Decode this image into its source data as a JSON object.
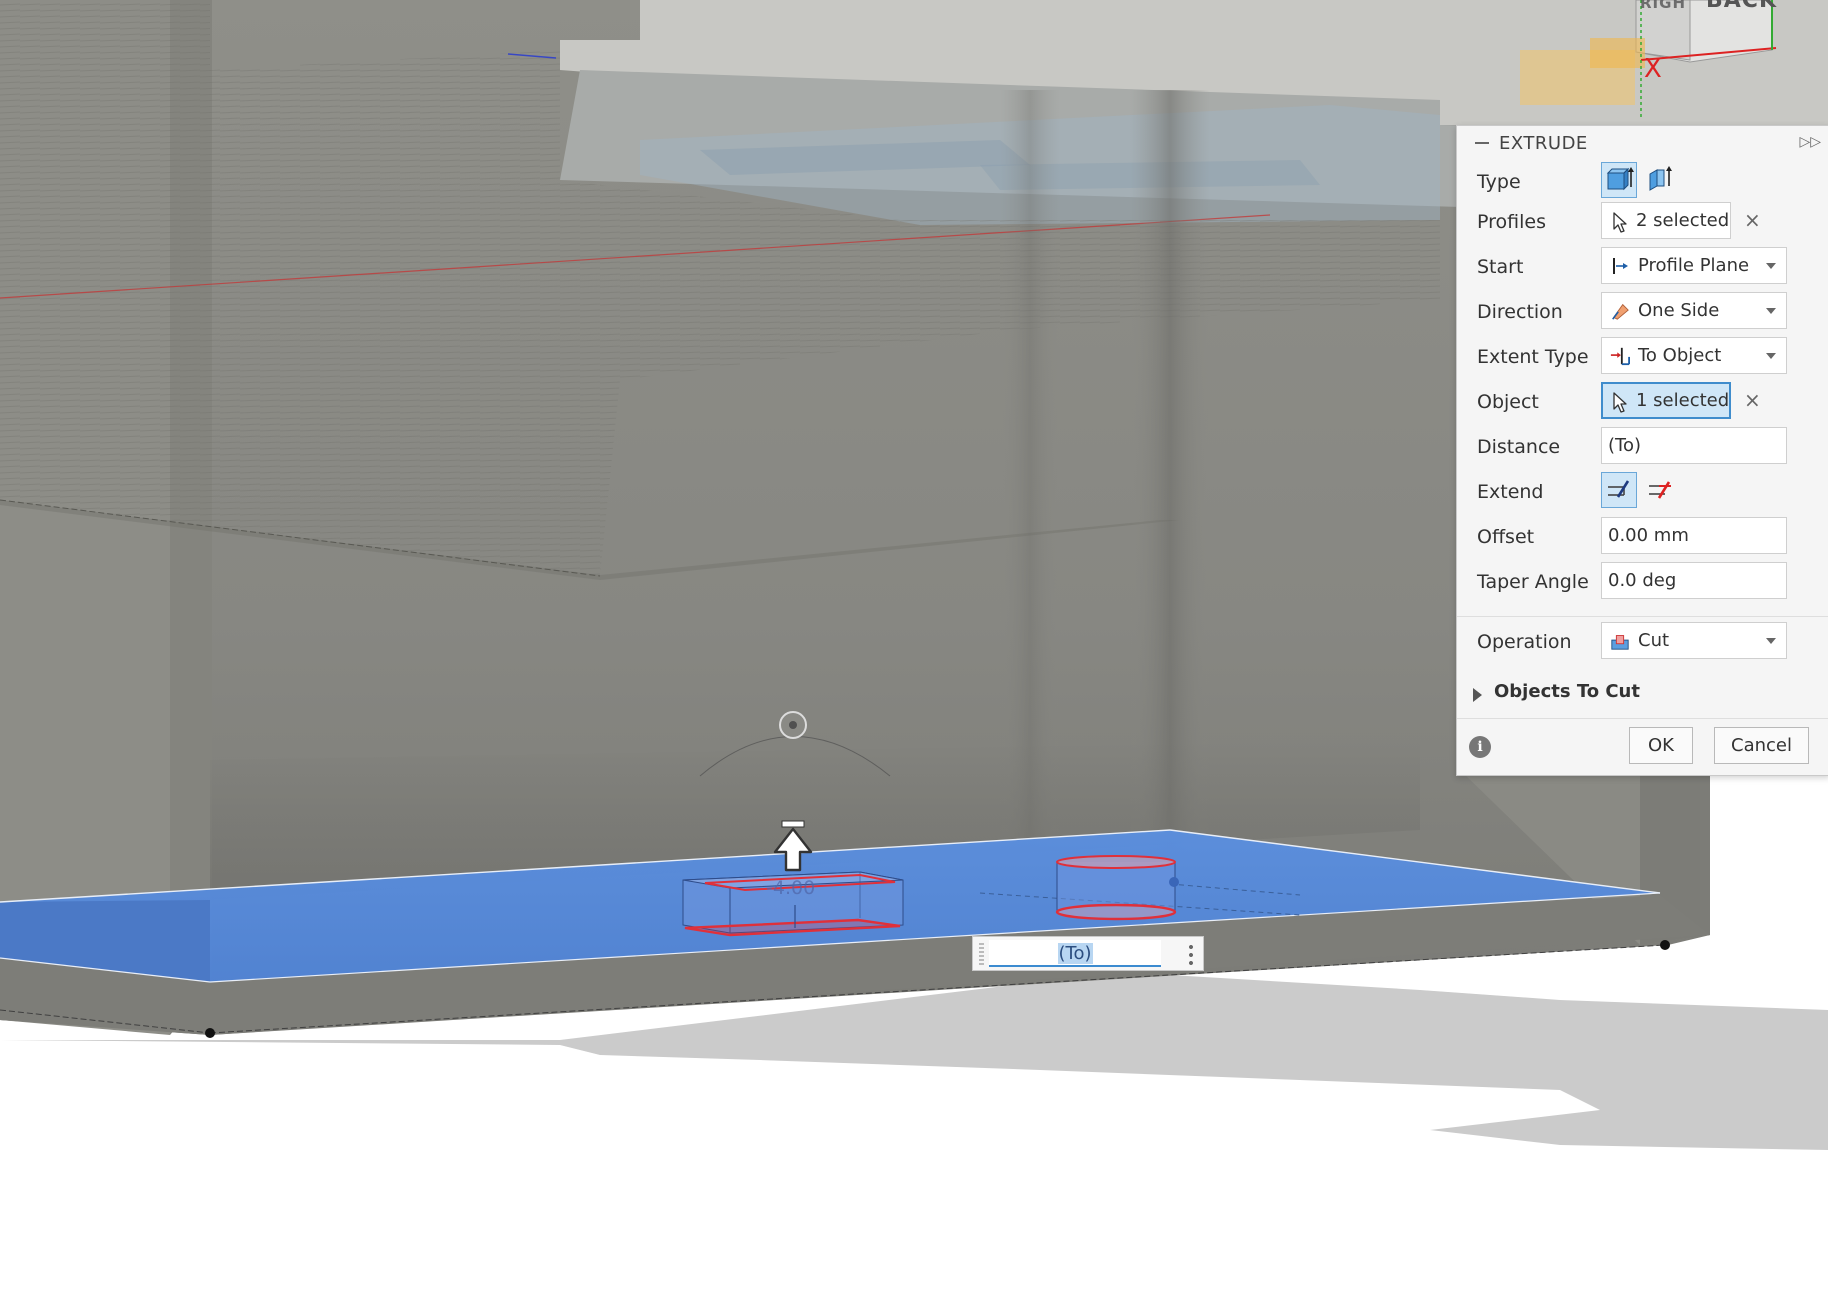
{
  "viewcube": {
    "right_label": "RIGH",
    "back_label": "BACK",
    "x_axis_label": "X"
  },
  "canvas": {
    "dimension_label": "-4.00",
    "inline_input_value": "(To)"
  },
  "dialog": {
    "title": "EXTRUDE",
    "rows": {
      "type": {
        "label": "Type",
        "options": [
          "solid-extrude-icon",
          "thin-extrude-icon"
        ],
        "selected": "solid-extrude-icon"
      },
      "profiles": {
        "label": "Profiles",
        "value": "2 selected"
      },
      "start": {
        "label": "Start",
        "value": "Profile Plane",
        "icon": "profile-plane-icon"
      },
      "direction": {
        "label": "Direction",
        "value": "One Side",
        "icon": "one-side-icon"
      },
      "extent_type": {
        "label": "Extent Type",
        "value": "To Object",
        "icon": "to-object-icon"
      },
      "object": {
        "label": "Object",
        "value": "1 selected"
      },
      "distance": {
        "label": "Distance",
        "value": "(To)"
      },
      "extend": {
        "label": "Extend",
        "options": [
          "extend-faces-icon",
          "no-extend-icon"
        ],
        "selected": "extend-faces-icon"
      },
      "offset": {
        "label": "Offset",
        "value": "0.00 mm"
      },
      "taper_angle": {
        "label": "Taper Angle",
        "value": "0.0 deg"
      },
      "operation": {
        "label": "Operation",
        "value": "Cut",
        "icon": "cut-icon"
      }
    },
    "objects_to_cut": {
      "label": "Objects To Cut",
      "expanded": false
    },
    "ok_label": "OK",
    "cancel_label": "Cancel"
  },
  "colors": {
    "accent": "#3f8ccc",
    "selection_blue": "#4f86d9",
    "cut_red": "#e0303a"
  }
}
